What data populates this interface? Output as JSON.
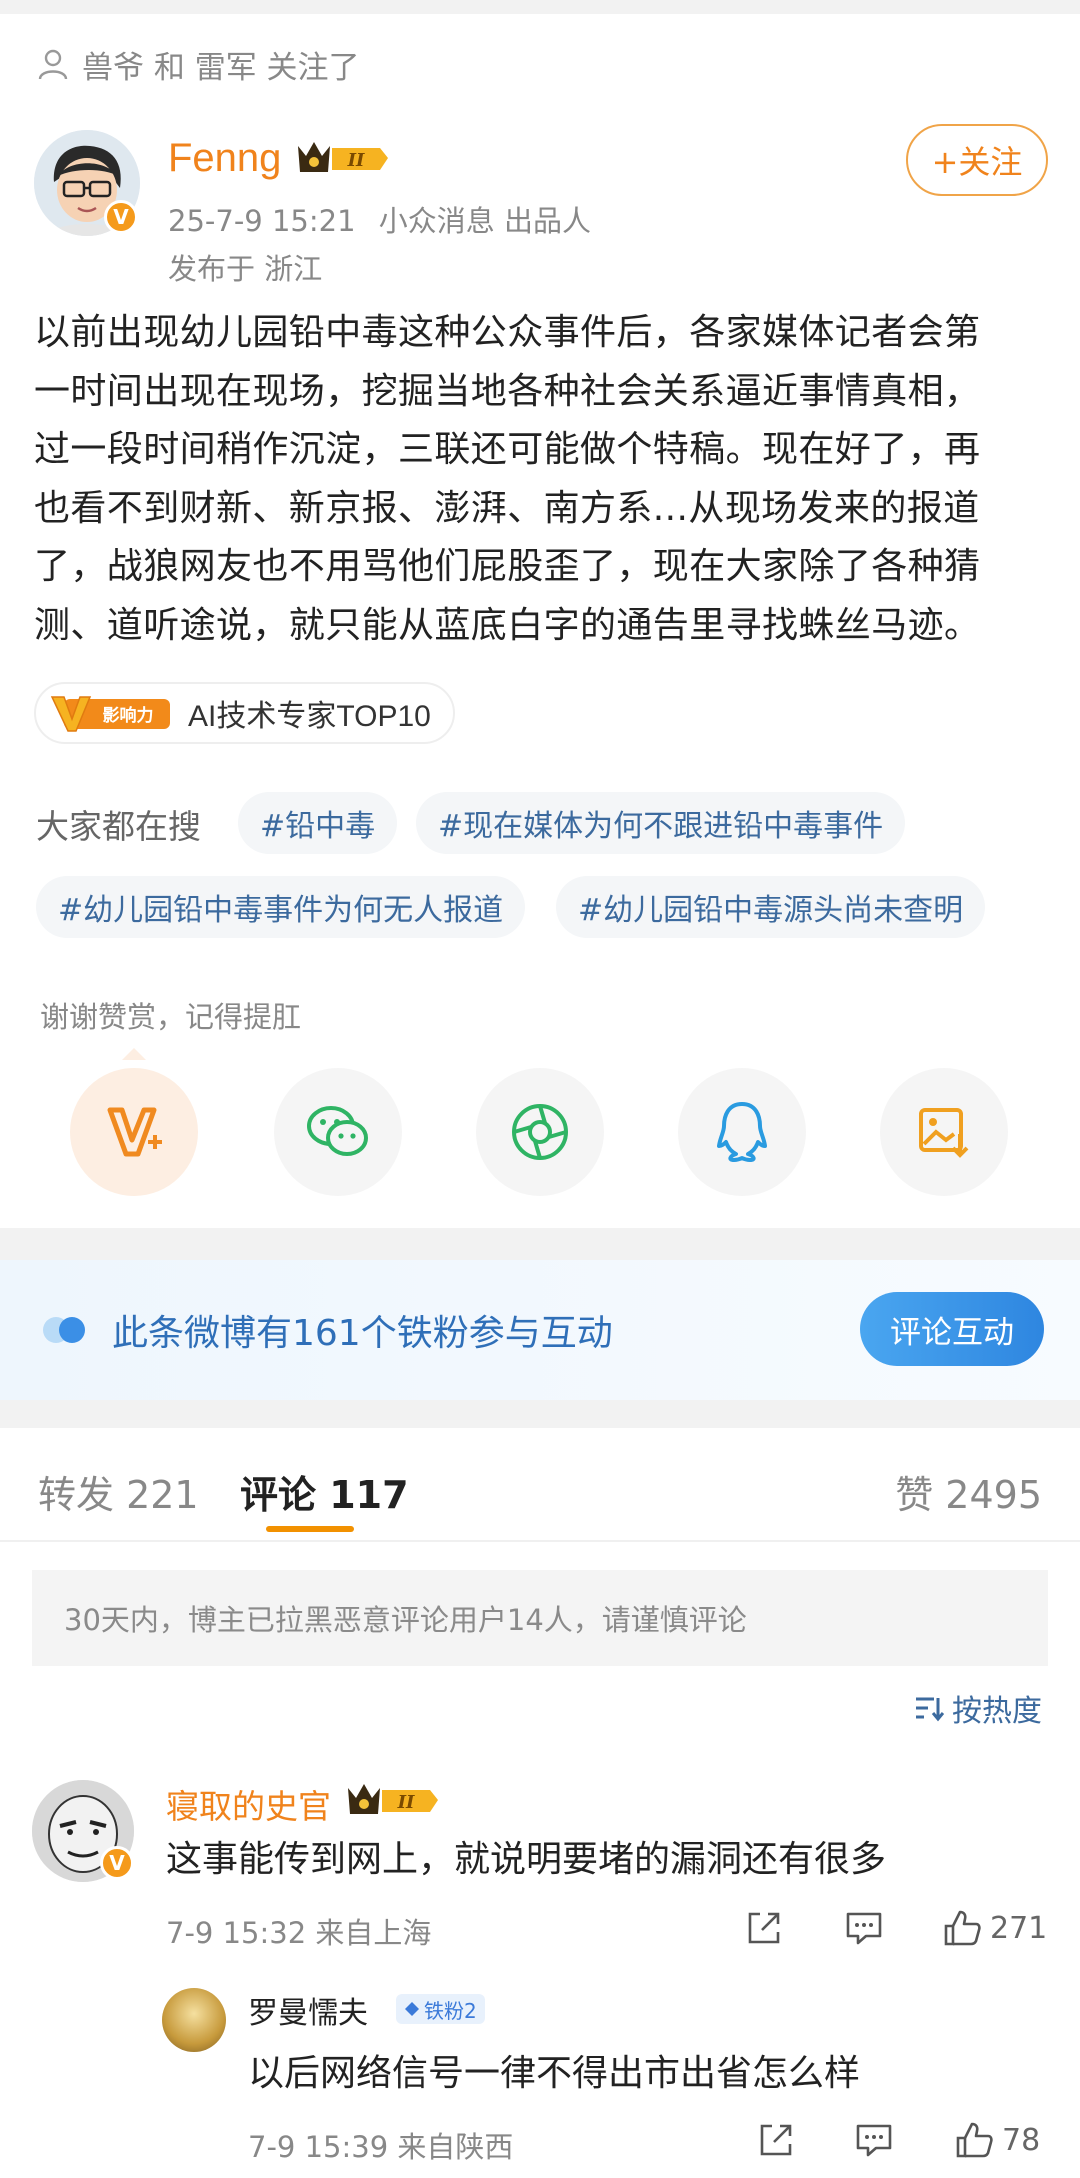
{
  "followed_by": "兽爷 和 雷军 关注了",
  "author": {
    "name": "Fenng",
    "level": "II",
    "time": "25-7-9 15:21",
    "source": "小众消息 出品人",
    "location": "发布于 浙江",
    "follow_label": "+关注"
  },
  "post": {
    "lines": [
      "以前出现幼儿园铅中毒这种公众事件后，各家媒体记者会第",
      "一时间出现在现场，挖掘当地各种社会关系逼近事情真相，",
      "过一段时间稍作沉淀，三联还可能做个特稿。现在好了，再",
      "也看不到财新、新京报、澎湃、南方系...从现场发来的报道",
      "了，战狼网友也不用骂他们屁股歪了，现在大家除了各种猜",
      "测、道听途说，就只能从蓝底白字的通告里寻找蛛丝马迹。"
    ]
  },
  "influence": {
    "logo_text": "影响力",
    "label": "AI技术专家TOP10"
  },
  "search": {
    "label": "大家都在搜",
    "tags": [
      "#铅中毒",
      "#现在媒体为何不跟进铅中毒事件",
      "#幼儿园铅中毒事件为何无人报道",
      "#幼儿园铅中毒源头尚未查明"
    ]
  },
  "thanks": "谢谢赞赏，记得提肛",
  "share_icons": [
    "v-plus-icon",
    "wechat-icon",
    "moments-icon",
    "qq-icon",
    "save-image-icon"
  ],
  "fans_banner": {
    "text": "此条微博有161个铁粉参与互动",
    "button": "评论互动"
  },
  "tabs": {
    "repost": "转发 221",
    "comment": "评论 117",
    "like": "赞 2495"
  },
  "notice": "30天内，博主已拉黑恶意评论用户14人，请谨慎评论",
  "sort": "按热度",
  "comment": {
    "name": "寝取的史官",
    "level": "II",
    "text": "这事能传到网上，就说明要堵的漏洞还有很多",
    "meta": "7-9 15:32  来自上海",
    "likes": "271"
  },
  "reply": {
    "name": "罗曼懦夫",
    "badge": "铁粉2",
    "text": "以后网络信号一律不得出市出省怎么样",
    "meta": "7-9 15:39  来自陕西",
    "likes": "78"
  },
  "colors": {
    "accent_orange": "#f0831c",
    "link_blue": "#3c6a9e",
    "tab_underline": "#f29100",
    "banner_button": "#2e86e0"
  }
}
